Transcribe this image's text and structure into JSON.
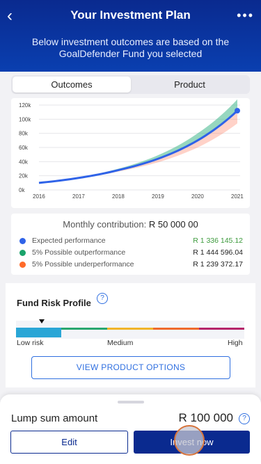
{
  "header": {
    "title": "Your Investment Plan",
    "back_icon": "chevron-left-icon",
    "more_icon": "more-icon",
    "subtitle": "Below investment outcomes are based on the GoalDefender Fund you selected"
  },
  "tabs": [
    {
      "label": "Outcomes",
      "active": true
    },
    {
      "label": "Product",
      "active": false
    }
  ],
  "chart_data": {
    "type": "area",
    "x": [
      "2016",
      "2017",
      "2018",
      "2019",
      "2020",
      "2021"
    ],
    "y_ticks": [
      "0k",
      "20k",
      "40k",
      "60k",
      "80k",
      "100k",
      "120k"
    ],
    "ylim": [
      0,
      120000
    ],
    "series": [
      {
        "name": "Expected performance",
        "color": "#2f63e8",
        "values": [
          10000,
          17000,
          28000,
          44000,
          70000,
          112000
        ]
      },
      {
        "name": "5% Possible outperformance",
        "color": "#3fb68b",
        "values": [
          10000,
          17800,
          30000,
          49000,
          80000,
          128000
        ]
      },
      {
        "name": "5% Possible underperformance",
        "color": "#ff6b4a",
        "values": [
          10000,
          16200,
          26000,
          39000,
          60000,
          94000
        ]
      }
    ]
  },
  "contribution": {
    "label": "Monthly contribution:",
    "value": "R 50 000 00",
    "rows": [
      {
        "label": "Expected performance",
        "value": "R 1 336 145.12",
        "color": "#2f63e8",
        "value_color": "#3c9a3c"
      },
      {
        "label": "5% Possible outperformance",
        "value": "R 1 444 596.04",
        "color": "#1aa36b",
        "value_color": "#222222"
      },
      {
        "label": "5% Possible underperformance",
        "value": "R 1 239 372.17",
        "color": "#ff6b2a",
        "value_color": "#222222"
      }
    ]
  },
  "risk": {
    "title": "Fund Risk Profile",
    "help_icon": "question-circle-icon",
    "low": "Low risk",
    "medium": "Medium",
    "high": "High",
    "view_button": "VIEW PRODUCT OPTIONS",
    "colors": [
      "#2aa6d6",
      "#28a66f",
      "#f0b429",
      "#ef6a2c",
      "#b5246a"
    ]
  },
  "bottom": {
    "lump_label": "Lump sum amount",
    "lump_value": "R 100 000",
    "edit": "Edit",
    "invest": "Invest now"
  }
}
